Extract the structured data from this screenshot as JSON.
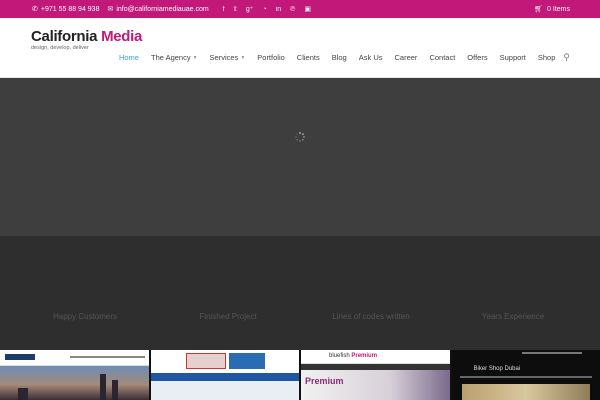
{
  "topbar": {
    "phone": "+971 55 88 94 938",
    "email": "info@californiamediauae.com",
    "social_icons": [
      "facebook-icon",
      "twitter-icon",
      "google-plus-icon",
      "rss-icon",
      "linkedin-icon",
      "pinterest-icon",
      "instagram-icon"
    ],
    "cart_label": "0 Items"
  },
  "logo": {
    "title_main": "California",
    "title_accent": "Media",
    "tagline": "design, develop, deliver"
  },
  "nav": {
    "items": [
      {
        "label": "Home",
        "active": true,
        "has_dropdown": false
      },
      {
        "label": "The Agency",
        "active": false,
        "has_dropdown": true
      },
      {
        "label": "Services",
        "active": false,
        "has_dropdown": true
      },
      {
        "label": "Portfolio",
        "active": false,
        "has_dropdown": false
      },
      {
        "label": "Clients",
        "active": false,
        "has_dropdown": false
      },
      {
        "label": "Blog",
        "active": false,
        "has_dropdown": false
      },
      {
        "label": "Ask Us",
        "active": false,
        "has_dropdown": false
      },
      {
        "label": "Career",
        "active": false,
        "has_dropdown": false
      },
      {
        "label": "Contact",
        "active": false,
        "has_dropdown": false
      },
      {
        "label": "Offers",
        "active": false,
        "has_dropdown": false
      },
      {
        "label": "Support",
        "active": false,
        "has_dropdown": false
      },
      {
        "label": "Shop",
        "active": false,
        "has_dropdown": false
      }
    ]
  },
  "counters": [
    {
      "label": "Happy Customers"
    },
    {
      "label": "Finished Project"
    },
    {
      "label": "Lines of codes written"
    },
    {
      "label": "Years Experience"
    }
  ],
  "portfolio": {
    "item3_brand_a": "bluefish",
    "item3_brand_b": "Premium",
    "item3_hero": "Premium",
    "item4_title": "Biker Shop Dubai"
  },
  "colors": {
    "brand": "#c2187a",
    "active_nav": "#2ea3f2"
  }
}
